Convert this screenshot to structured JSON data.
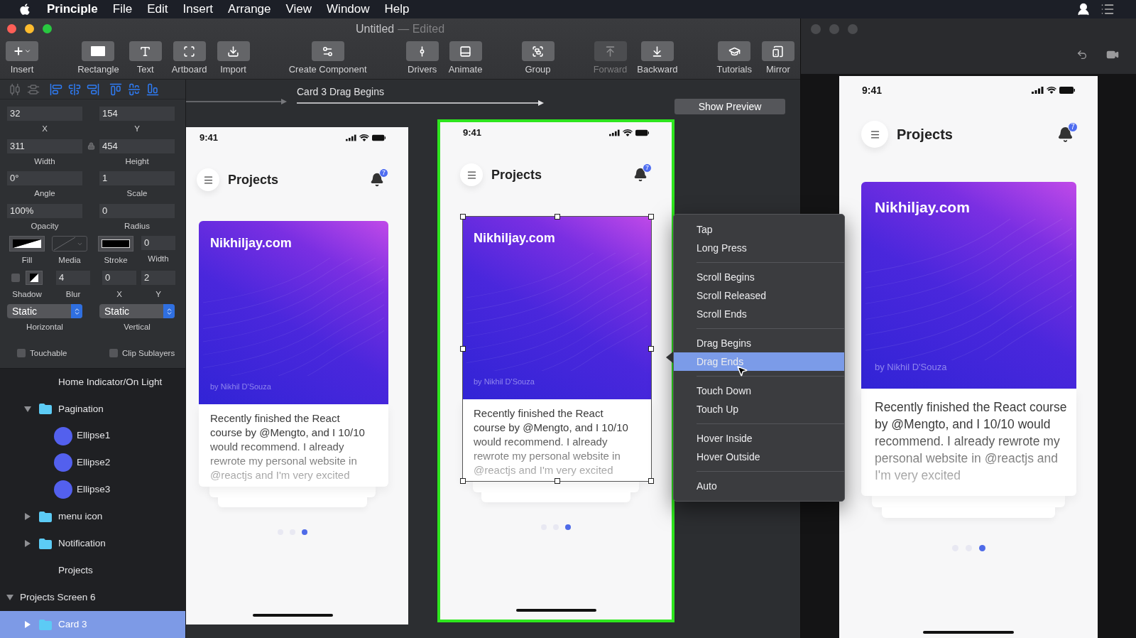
{
  "menu_bar": {
    "app": "Principle",
    "items": [
      "File",
      "Edit",
      "Insert",
      "Arrange",
      "View",
      "Window",
      "Help"
    ]
  },
  "window": {
    "title": "Untitled",
    "edited_label": "— Edited"
  },
  "toolbar": [
    {
      "items": [
        {
          "kind": "insert",
          "label": "Insert",
          "disabled": false
        }
      ]
    },
    {
      "items": [
        {
          "kind": "rectangle",
          "label": "Rectangle",
          "disabled": false
        },
        {
          "kind": "text",
          "label": "Text",
          "disabled": false
        },
        {
          "kind": "artboard",
          "label": "Artboard",
          "disabled": false
        },
        {
          "kind": "import",
          "label": "Import",
          "disabled": false
        }
      ]
    },
    {
      "items": [
        {
          "kind": "component",
          "label": "Create Component",
          "disabled": false
        }
      ]
    },
    {
      "items": [
        {
          "kind": "drivers",
          "label": "Drivers",
          "disabled": false
        },
        {
          "kind": "animate",
          "label": "Animate",
          "disabled": false
        }
      ]
    },
    {
      "items": [
        {
          "kind": "group",
          "label": "Group",
          "disabled": false
        }
      ]
    },
    {
      "items": [
        {
          "kind": "forward",
          "label": "Forward",
          "disabled": true
        },
        {
          "kind": "backward",
          "label": "Backward",
          "disabled": false
        }
      ]
    },
    {
      "items": [
        {
          "kind": "tutorials",
          "label": "Tutorials",
          "disabled": false
        },
        {
          "kind": "mirror",
          "label": "Mirror",
          "disabled": false
        }
      ]
    }
  ],
  "properties": {
    "fields": [
      {
        "label": "X",
        "value": "32"
      },
      {
        "label": "Y",
        "value": "154"
      },
      {
        "label": "Width",
        "value": "311"
      },
      {
        "label": "Height",
        "value": "454"
      },
      {
        "label": "Angle",
        "value": "0°"
      },
      {
        "label": "Scale",
        "value": "1"
      },
      {
        "label": "Opacity",
        "value": "100%"
      },
      {
        "label": "Radius",
        "value": "0"
      }
    ],
    "appearance": [
      {
        "kind": "fill",
        "label": "Fill"
      },
      {
        "kind": "media",
        "label": "Media"
      },
      {
        "kind": "stroke",
        "label": "Stroke"
      },
      {
        "kind": "field",
        "label": "Width",
        "value": "0"
      }
    ],
    "shadow": [
      {
        "kind": "toggle",
        "label": "Shadow",
        "checked": false
      },
      {
        "kind": "field",
        "label": "Blur",
        "value": "4"
      },
      {
        "kind": "field",
        "label": "X",
        "value": "0"
      },
      {
        "kind": "field",
        "label": "Y",
        "value": "2"
      }
    ],
    "selects": [
      {
        "label": "Horizontal",
        "value": "Static"
      },
      {
        "label": "Vertical",
        "value": "Static"
      }
    ],
    "checkboxes": [
      {
        "label": "Touchable",
        "checked": false
      },
      {
        "label": "Clip Sublayers",
        "checked": false
      }
    ]
  },
  "layers": [
    {
      "kind": "screen",
      "children": [
        {
          "kind": "text",
          "label": "Home Indicator/On Light",
          "selected": false
        },
        {
          "kind": "folder",
          "label": "Pagination",
          "expanded": true,
          "selected": false,
          "children": [
            {
              "kind": "ellipse",
              "label": "Ellipse1",
              "selected": false
            },
            {
              "kind": "ellipse",
              "label": "Ellipse2",
              "selected": false
            },
            {
              "kind": "ellipse",
              "label": "Ellipse3",
              "selected": false
            }
          ]
        },
        {
          "kind": "folder",
          "label": "menu icon",
          "expanded": false,
          "selected": false
        },
        {
          "kind": "folder",
          "label": "Notification",
          "expanded": false,
          "selected": false
        },
        {
          "kind": "text",
          "label": "Projects",
          "selected": false
        }
      ]
    },
    {
      "kind": "screen",
      "label": "Projects Screen 6",
      "expanded": true,
      "selected": false,
      "children": [
        {
          "kind": "folder",
          "label": "Card 3",
          "expanded": false,
          "selected": true
        }
      ]
    }
  ],
  "canvas": {
    "transition_label": "Card 3 Drag Begins",
    "show_preview": "Show Preview",
    "artboards": [
      {
        "selected": false,
        "time": "9:41",
        "title": "Projects",
        "badge": "7",
        "card": {
          "title": "Nikhiljay.com",
          "author": "by Nikhil D'Souza",
          "body": "Recently finished the React course by @Mengto, and I 10/10 would recommend. I already rewrote my personal website in @reactjs and I'm very excited"
        },
        "dots": [
          {
            "selected": false
          },
          {
            "selected": false
          },
          {
            "selected": true
          }
        ]
      },
      {
        "selected": true,
        "time": "9:41",
        "title": "Projects",
        "badge": "7",
        "card": {
          "title": "Nikhiljay.com",
          "author": "by Nikhil D'Souza",
          "body": "Recently finished the React course by @Mengto, and I 10/10 would recommend. I already rewrote my personal website in @reactjs and I'm very excited"
        },
        "dots": [
          {
            "selected": false
          },
          {
            "selected": false
          },
          {
            "selected": true
          }
        ]
      }
    ]
  },
  "event_menu": {
    "groups": [
      {
        "items": [
          {
            "label": "Tap",
            "selected": false
          },
          {
            "label": "Long Press",
            "selected": false
          }
        ]
      },
      {
        "items": [
          {
            "label": "Scroll Begins",
            "selected": false
          },
          {
            "label": "Scroll Released",
            "selected": false
          },
          {
            "label": "Scroll Ends",
            "selected": false
          }
        ]
      },
      {
        "items": [
          {
            "label": "Drag Begins",
            "selected": false
          },
          {
            "label": "Drag Ends",
            "selected": true
          }
        ]
      },
      {
        "items": [
          {
            "label": "Touch Down",
            "selected": false
          },
          {
            "label": "Touch Up",
            "selected": false
          }
        ]
      },
      {
        "items": [
          {
            "label": "Hover Inside",
            "selected": false
          },
          {
            "label": "Hover Outside",
            "selected": false
          }
        ]
      },
      {
        "items": [
          {
            "label": "Auto",
            "selected": false
          }
        ]
      }
    ]
  },
  "preview": {
    "time": "9:41",
    "title": "Projects",
    "badge": "7",
    "card": {
      "title": "Nikhiljay.com",
      "author": "by Nikhil D'Souza",
      "body": "Recently finished the React course by @Mengto, and I 10/10 would recommend. I already rewrote my personal website in @reactjs and I'm very excited"
    },
    "dots": [
      {
        "selected": false
      },
      {
        "selected": false
      },
      {
        "selected": true
      }
    ]
  }
}
